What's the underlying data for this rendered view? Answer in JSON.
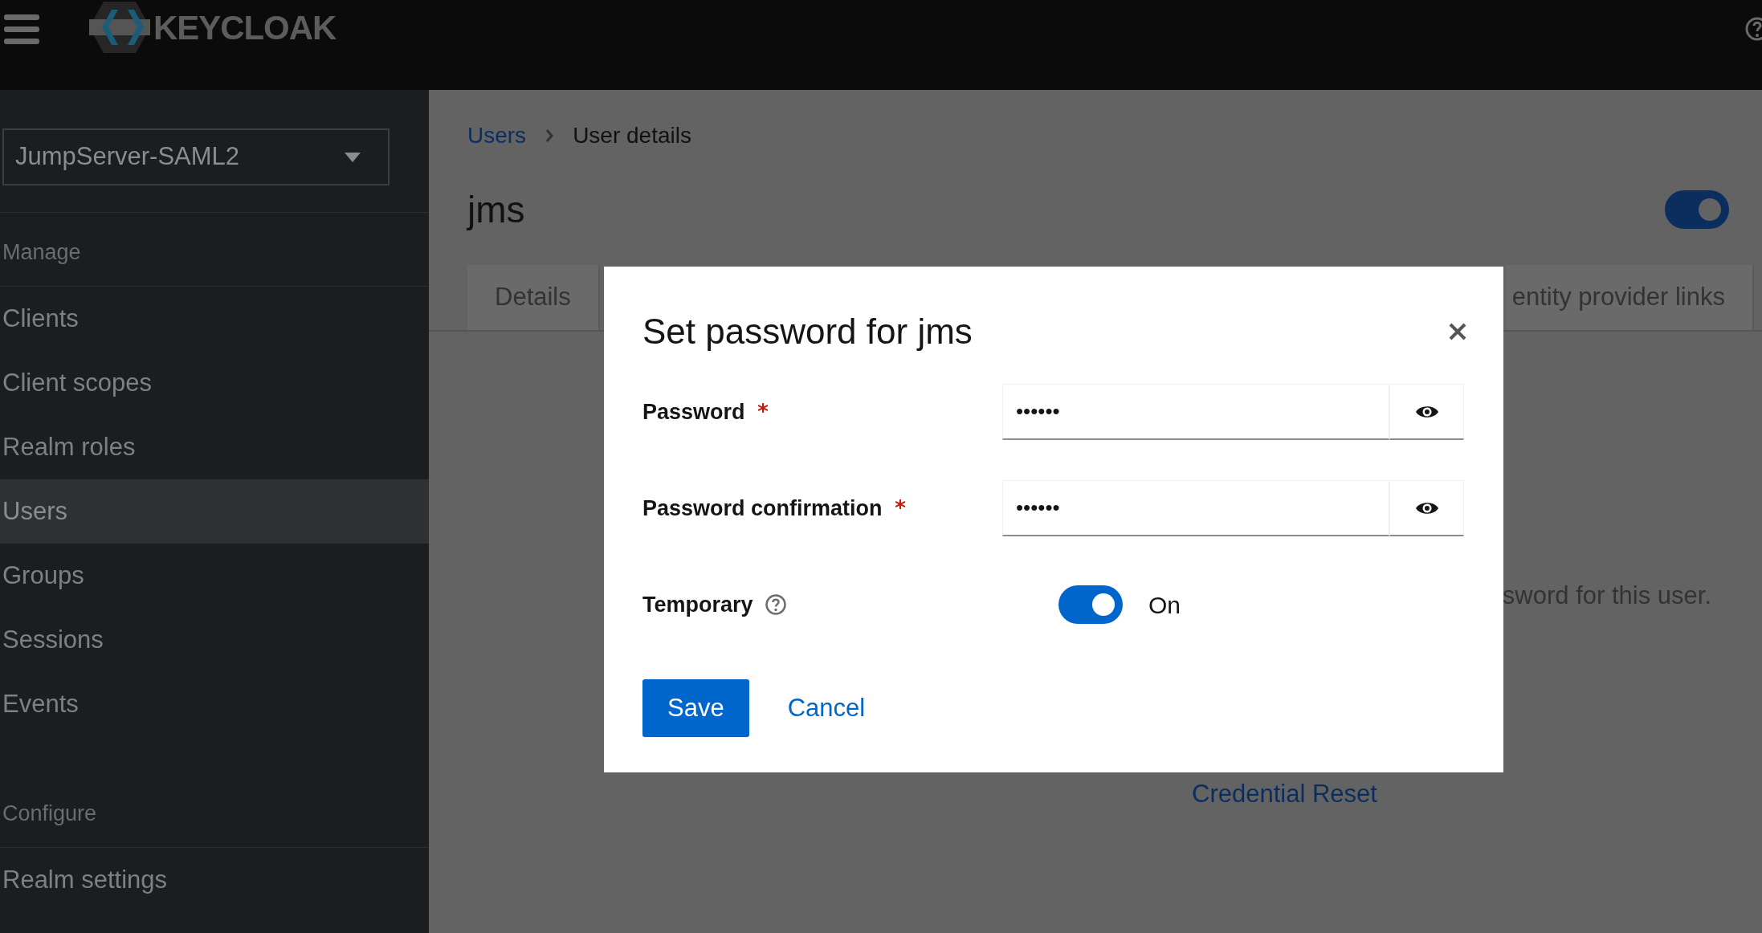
{
  "header": {
    "logo": "KEYCLOAK"
  },
  "sidebar": {
    "realm": "JumpServer-SAML2",
    "sections": [
      {
        "heading": "Manage",
        "items": [
          {
            "label": "Clients",
            "selected": false
          },
          {
            "label": "Client scopes",
            "selected": false
          },
          {
            "label": "Realm roles",
            "selected": false
          },
          {
            "label": "Users",
            "selected": true
          },
          {
            "label": "Groups",
            "selected": false
          },
          {
            "label": "Sessions",
            "selected": false
          },
          {
            "label": "Events",
            "selected": false
          }
        ]
      },
      {
        "heading": "Configure",
        "items": [
          {
            "label": "Realm settings",
            "selected": false
          }
        ]
      }
    ]
  },
  "breadcrumb": [
    {
      "label": "Users",
      "kind": "link"
    },
    {
      "label": "User details",
      "kind": "current"
    }
  ],
  "user": {
    "name": "jms",
    "enabled": true
  },
  "tabs": [
    {
      "label": "Details",
      "selected": false
    },
    {
      "label": "entity provider links",
      "selected": false
    }
  ],
  "content": {
    "text": "sword for this user.",
    "link": "Credential Reset"
  },
  "dialog": {
    "title": "Set password for jms",
    "fields": [
      {
        "label": "Password",
        "required": true,
        "value": "••••••"
      },
      {
        "label": "Password confirmation",
        "required": true,
        "value": "••••••"
      }
    ],
    "temporary": {
      "label": "Temporary",
      "on": true,
      "state_label": "On"
    },
    "buttons": [
      {
        "label": "Save",
        "kind": "primary"
      },
      {
        "label": "Cancel",
        "kind": "link"
      }
    ]
  }
}
